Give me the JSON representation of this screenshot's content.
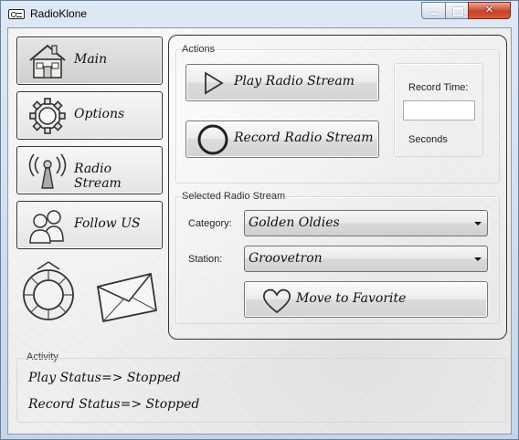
{
  "window": {
    "title": "RadioKlone"
  },
  "nav": {
    "main": "Main",
    "options": "Options",
    "radio_stream": "Radio Stream",
    "follow_us": "Follow US"
  },
  "actions": {
    "group_title": "Actions",
    "play_label": "Play Radio Stream",
    "record_label": "Record Radio Stream",
    "record_time_label": "Record Time:",
    "record_time_value": "",
    "seconds_label": "Seconds"
  },
  "stream": {
    "group_title": "Selected Radio Stream",
    "category_label": "Category:",
    "category_value": "Golden Oldies",
    "station_label": "Station:",
    "station_value": "Groovetron",
    "favorite_label": "Move to Favorite"
  },
  "activity": {
    "group_title": "Activity",
    "play_status": "Play Status=> Stopped",
    "record_status": "Record Status=> Stopped"
  }
}
